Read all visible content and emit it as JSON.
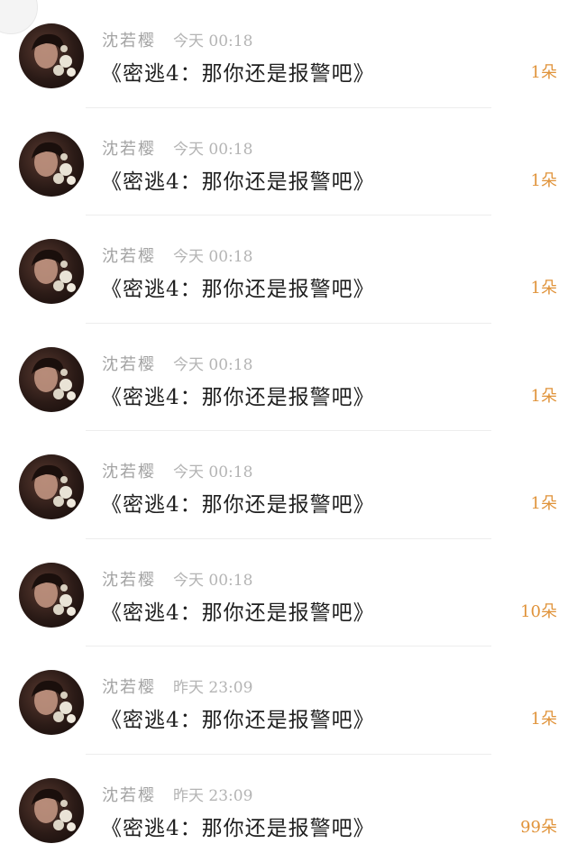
{
  "messages": [
    {
      "sender": "沈若樱",
      "time": "今天 00:18",
      "title": "《密逃4：那你还是报警吧》",
      "count": "1朵",
      "avatar_icon": "user-avatar-photo"
    },
    {
      "sender": "沈若樱",
      "time": "今天 00:18",
      "title": "《密逃4：那你还是报警吧》",
      "count": "1朵",
      "avatar_icon": "user-avatar-photo"
    },
    {
      "sender": "沈若樱",
      "time": "今天 00:18",
      "title": "《密逃4：那你还是报警吧》",
      "count": "1朵",
      "avatar_icon": "user-avatar-photo"
    },
    {
      "sender": "沈若樱",
      "time": "今天 00:18",
      "title": "《密逃4：那你还是报警吧》",
      "count": "1朵",
      "avatar_icon": "user-avatar-photo"
    },
    {
      "sender": "沈若樱",
      "time": "今天 00:18",
      "title": "《密逃4：那你还是报警吧》",
      "count": "1朵",
      "avatar_icon": "user-avatar-photo"
    },
    {
      "sender": "沈若樱",
      "time": "今天 00:18",
      "title": "《密逃4：那你还是报警吧》",
      "count": "10朵",
      "avatar_icon": "user-avatar-photo"
    },
    {
      "sender": "沈若樱",
      "time": "昨天 23:09",
      "title": "《密逃4：那你还是报警吧》",
      "count": "1朵",
      "avatar_icon": "user-avatar-photo"
    },
    {
      "sender": "沈若樱",
      "time": "昨天 23:09",
      "title": "《密逃4：那你还是报警吧》",
      "count": "99朵",
      "avatar_icon": "user-avatar-photo"
    }
  ],
  "colors": {
    "count_accent": "#e0933a",
    "name_gray": "#a3a3a3",
    "title_text": "#1f1f1f"
  }
}
